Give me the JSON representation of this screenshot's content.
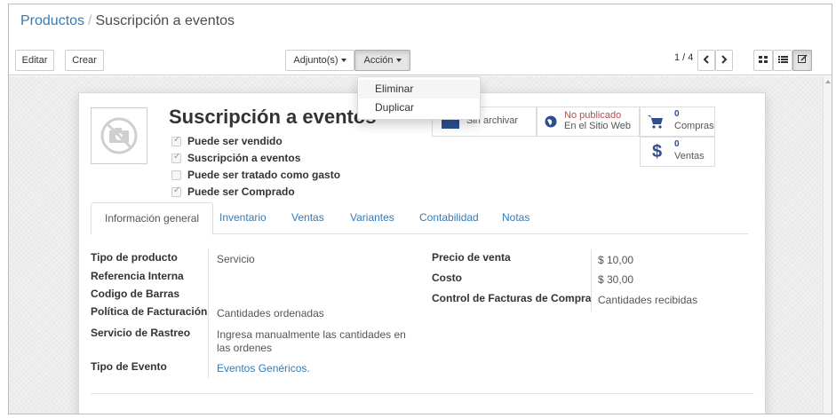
{
  "breadcrumb": {
    "parent": "Productos",
    "separator": "/",
    "current": "Suscripción a eventos"
  },
  "toolbar": {
    "edit_label": "Editar",
    "create_label": "Crear",
    "attachments_label": "Adjunto(s)",
    "action_label": "Acción"
  },
  "pager": {
    "value": "1 / 4"
  },
  "action_menu": {
    "items": [
      "Eliminar",
      "Duplicar"
    ]
  },
  "record": {
    "title": "Suscripción a eventos",
    "checkboxes": [
      {
        "label": "Puede ser vendido",
        "checked": true
      },
      {
        "label": "Suscripción a eventos",
        "checked": true
      },
      {
        "label": "Puede ser tratado como gasto",
        "checked": false
      },
      {
        "label": "Puede ser Comprado",
        "checked": true
      }
    ]
  },
  "smart_buttons": {
    "archive_label": "Sin archivar",
    "publish_status": "No publicado",
    "publish_site": "En el Sitio Web",
    "purchases_count": "0",
    "purchases_label": "Compras",
    "sales_count": "0",
    "sales_label": "Ventas",
    "dollar_symbol": "$"
  },
  "tabs": [
    "Información general",
    "Inventario",
    "Ventas",
    "Variantes",
    "Contabilidad",
    "Notas"
  ],
  "fields_left": [
    {
      "label": "Tipo de producto",
      "value": "Servicio"
    },
    {
      "label": "Referencia Interna",
      "value": ""
    },
    {
      "label": "Codigo de Barras",
      "value": ""
    },
    {
      "label": "Política de Facturación",
      "value": "Cantidades ordenadas"
    },
    {
      "label": "Servicio de Rastreo",
      "value_line1": "Ingresa manualmente las cantidades en",
      "value_line2": "las ordenes"
    },
    {
      "label": "Tipo de Evento",
      "value": "Eventos Genéricos."
    }
  ],
  "fields_right": [
    {
      "label": "Precio de venta",
      "value": "$ 10,00"
    },
    {
      "label": "Costo",
      "value": "$ 30,00"
    },
    {
      "label": "Control de Facturas de Compra",
      "value": "Cantidades recibidas"
    }
  ],
  "colors": {
    "link": "#337ab7",
    "publish_red": "#b74c4c",
    "smart_blue": "#2c4e93"
  }
}
